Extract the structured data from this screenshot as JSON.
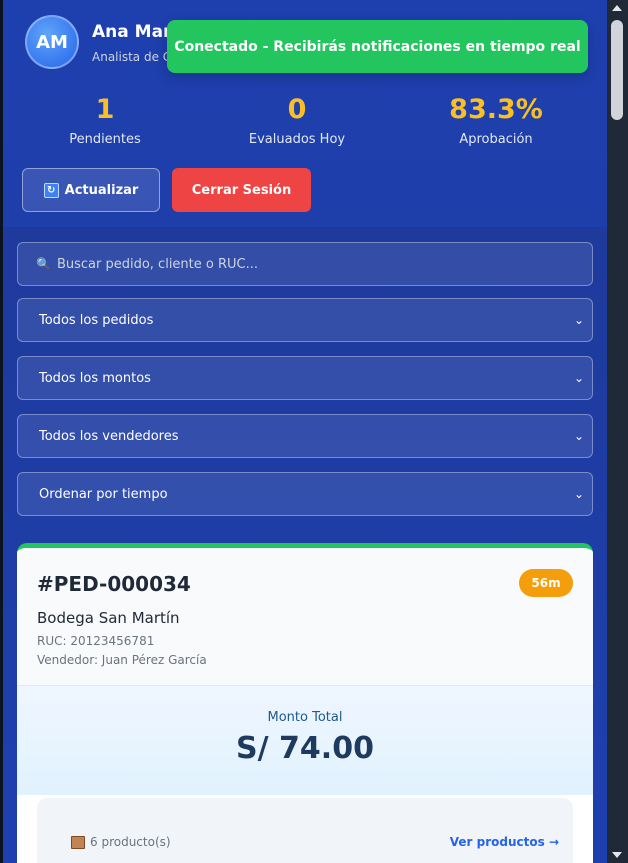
{
  "user": {
    "initials": "AM",
    "name": "Ana Martínez",
    "role": "Analista de Crédito"
  },
  "notification": {
    "message": "Conectado - Recibirás notificaciones en tiempo real",
    "color": "#22c55e"
  },
  "stats": [
    {
      "value": "1",
      "label": "Pendientes"
    },
    {
      "value": "0",
      "label": "Evaluados Hoy"
    },
    {
      "value": "83.3%",
      "label": "Aprobación"
    }
  ],
  "actions": {
    "refresh_icon": "refresh-icon",
    "refresh_label": "Actualizar",
    "logout_label": "Cerrar Sesión",
    "logout_color": "#ef4444"
  },
  "filters": {
    "search_placeholder": "Buscar pedido, cliente o RUC...",
    "selects": [
      "Todos los pedidos",
      "Todos los montos",
      "Todos los vendedores",
      "Ordenar por tiempo"
    ]
  },
  "order": {
    "id": "#PED-000034",
    "time": "56m",
    "client": "Bodega San Martín",
    "ruc": "RUC: 20123456781",
    "seller": "Vendedor: Juan Pérez García",
    "amount_label": "Monto Total",
    "amount": "S/ 74.00",
    "products_count": "6 producto(s)",
    "view_products": "Ver productos →",
    "status_color": "#22c55e"
  },
  "colors": {
    "header_bg": "#1e40af",
    "stat_value": "#fbbf24",
    "time_badge": "#f59e0b"
  }
}
